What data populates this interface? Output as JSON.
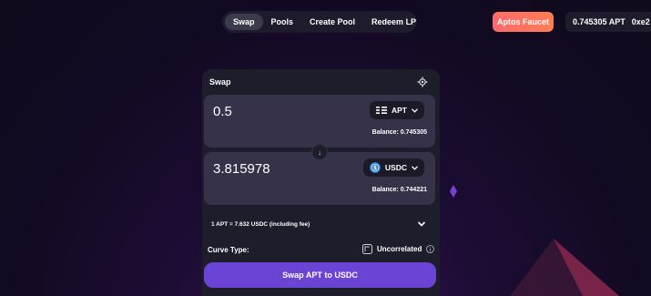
{
  "nav": {
    "items": [
      "Swap",
      "Pools",
      "Create Pool",
      "Redeem LP"
    ]
  },
  "header": {
    "faucet_label": "Aptos Faucet",
    "wallet_balance": "0.745305 APT",
    "address": "0xe2"
  },
  "swap": {
    "title": "Swap",
    "from": {
      "amount": "0.5",
      "token": "APT",
      "balance": "Balance: 0.745305"
    },
    "to": {
      "amount": "3.815978",
      "token": "USDC",
      "balance": "Balance: 0.744221"
    },
    "rate": "1 APT = 7.632 USDC (including fee)",
    "curve_label": "Curve Type:",
    "curve_value": "Uncorrelated",
    "cta": "Swap APT to USDC"
  },
  "colors": {
    "accent": "#6b44d6",
    "faucet": "#ff6a6a",
    "usdc": "#2775ca"
  }
}
